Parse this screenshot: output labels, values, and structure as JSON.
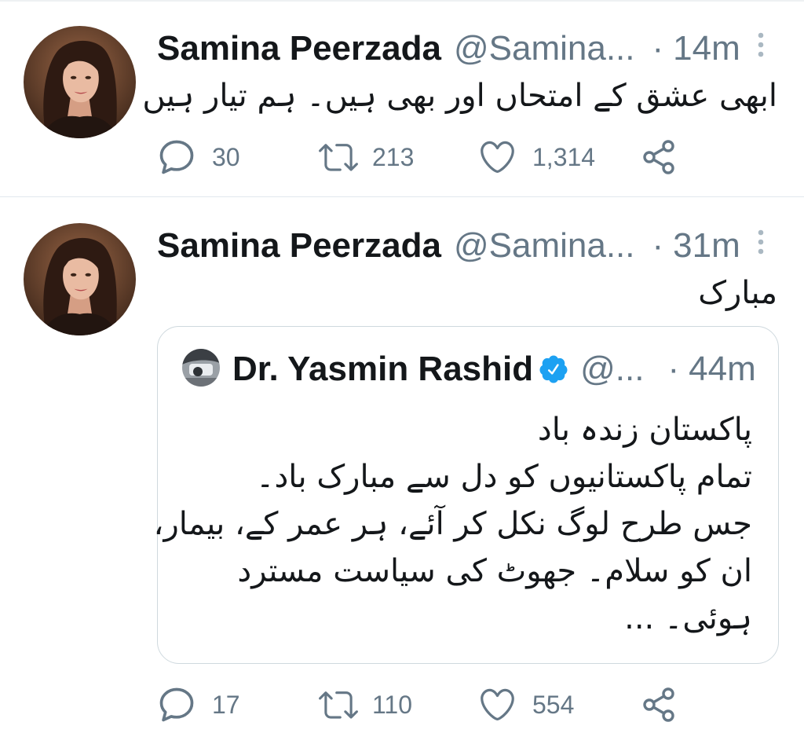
{
  "tweets": [
    {
      "author": {
        "name": "Samina Peerzada",
        "handle": "@Samina..."
      },
      "time": "14m",
      "text": "ابھی عشق کے امتحاں اور بھی ہیں۔ ہم تیار ہیں",
      "stats": {
        "replies": "30",
        "retweets": "213",
        "likes": "1,314"
      }
    },
    {
      "author": {
        "name": "Samina Peerzada",
        "handle": "@Samina..."
      },
      "time": "31m",
      "text": "مبارک",
      "quoted_tweet": {
        "author": {
          "name": "Dr. Yasmin Rashid",
          "handle": "@...",
          "verified": true
        },
        "time": "44m",
        "lines": [
          "پاکستان زندہ باد",
          "تمام پاکستانیوں کو دل سے مبارک باد۔",
          "جس طرح لوگ نکل کر آئے، ہر عمر کے، بیمار،",
          "ان کو سلام۔ جھوٹ کی سیاست مسترد",
          "ہوئی۔ ..."
        ]
      },
      "stats": {
        "replies": "17",
        "retweets": "110",
        "likes": "554"
      }
    }
  ],
  "meta_separator": "·",
  "icons": {
    "more": "more-vertical-icon",
    "reply": "reply-icon",
    "retweet": "retweet-icon",
    "like": "heart-icon",
    "share": "share-icon",
    "verified": "verified-badge-icon"
  },
  "colors": {
    "text": "#14171a",
    "secondary": "#657786",
    "more_icon": "#aab8c2",
    "verified": "#1da1f2",
    "border": "#cfd9de",
    "divider": "#e1e8ed",
    "background": "#ffffff"
  }
}
